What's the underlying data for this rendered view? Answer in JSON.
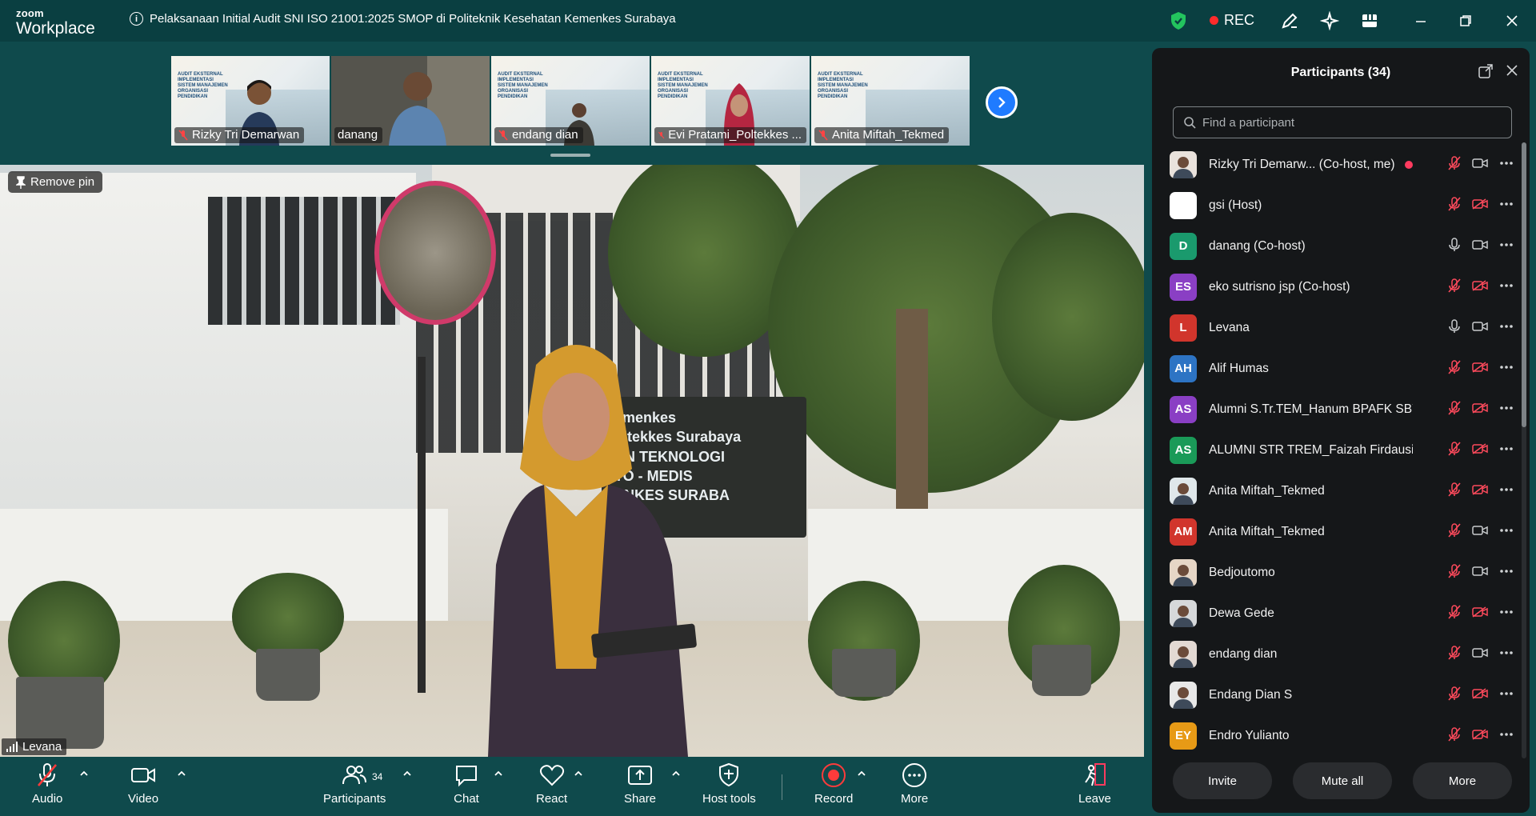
{
  "app": {
    "brand_top": "zoom",
    "brand_bottom": "Workplace",
    "meeting_title": "Pelaksanaan Initial Audit SNI ISO 21001:2025 SMOP di Politeknik Kesehatan Kemenkes Surabaya",
    "rec_label": "REC",
    "colors": {
      "background": "#0f4a4c",
      "rec": "#ff2b2b",
      "accent": "#1f7bff",
      "panel": "#151719"
    }
  },
  "thumbnails": [
    {
      "name": "Rizky Tri Demarwan",
      "muted": true,
      "type": "slide"
    },
    {
      "name": "danang",
      "muted": false,
      "type": "camera"
    },
    {
      "name": "endang dian",
      "muted": true,
      "type": "slide"
    },
    {
      "name": "Evi Pratami_Poltekkes ...",
      "muted": true,
      "type": "slide"
    },
    {
      "name": "Anita Miftah_Tekmed",
      "muted": true,
      "type": "slide"
    }
  ],
  "main_video": {
    "remove_pin_label": "Remove pin",
    "speaker_name": "Levana",
    "sign_text": "emenkes\noltekkes Surabaya\nAN TEKNOLOGI\nTO - MEDIS\nENKES SURABA"
  },
  "toolbar": {
    "audio": "Audio",
    "video": "Video",
    "participants": "Participants",
    "participants_count": "34",
    "chat": "Chat",
    "react": "React",
    "share": "Share",
    "host_tools": "Host tools",
    "record": "Record",
    "more": "More",
    "leave": "Leave"
  },
  "panel": {
    "title": "Participants (34)",
    "search_placeholder": "Find a participant",
    "participants": [
      {
        "name": "Rizky Tri Demarw...  (Co-host, me)",
        "initials": "",
        "color": "#e9e2dc",
        "mic": "muted",
        "cam": "on",
        "photo": true,
        "recording": true
      },
      {
        "name": "gsi (Host)",
        "initials": "",
        "color": "#ffffff",
        "mic": "muted",
        "cam": "off",
        "photo": false
      },
      {
        "name": "danang (Co-host)",
        "initials": "D",
        "color": "#1a9a6d",
        "mic": "on",
        "cam": "on",
        "photo": false
      },
      {
        "name": "eko sutrisno jsp (Co-host)",
        "initials": "ES",
        "color": "#8a3fc4",
        "mic": "muted",
        "cam": "off",
        "photo": false
      },
      {
        "name": "Levana",
        "initials": "L",
        "color": "#d1352c",
        "mic": "on",
        "cam": "on",
        "photo": false
      },
      {
        "name": "Alif Humas",
        "initials": "AH",
        "color": "#2d74c4",
        "mic": "muted",
        "cam": "off",
        "photo": false
      },
      {
        "name": "Alumni S.Tr.TEM_Hanum BPAFK SBY",
        "initials": "AS",
        "color": "#8a3fc4",
        "mic": "muted",
        "cam": "off",
        "photo": false
      },
      {
        "name": "ALUMNI STR TREM_Faizah Firdausi ...",
        "initials": "AS",
        "color": "#1a9a58",
        "mic": "muted",
        "cam": "off",
        "photo": false
      },
      {
        "name": "Anita Miftah_Tekmed",
        "initials": "",
        "color": "#dfe7ea",
        "mic": "muted",
        "cam": "off",
        "photo": true
      },
      {
        "name": "Anita Miftah_Tekmed",
        "initials": "AM",
        "color": "#d1352c",
        "mic": "muted",
        "cam": "on",
        "photo": false
      },
      {
        "name": "Bedjoutomo",
        "initials": "",
        "color": "#e6d6c6",
        "mic": "muted",
        "cam": "on",
        "photo": true
      },
      {
        "name": "Dewa Gede",
        "initials": "",
        "color": "#d6d8da",
        "mic": "muted",
        "cam": "off",
        "photo": true
      },
      {
        "name": "endang dian",
        "initials": "",
        "color": "#e3d9d3",
        "mic": "muted",
        "cam": "on",
        "photo": true
      },
      {
        "name": "Endang Dian S",
        "initials": "",
        "color": "#e8e8e8",
        "mic": "muted",
        "cam": "off",
        "photo": true
      },
      {
        "name": "Endro Yulianto",
        "initials": "EY",
        "color": "#e79a16",
        "mic": "muted",
        "cam": "off",
        "photo": false
      }
    ],
    "buttons": {
      "invite": "Invite",
      "mute_all": "Mute all",
      "more": "More"
    }
  }
}
